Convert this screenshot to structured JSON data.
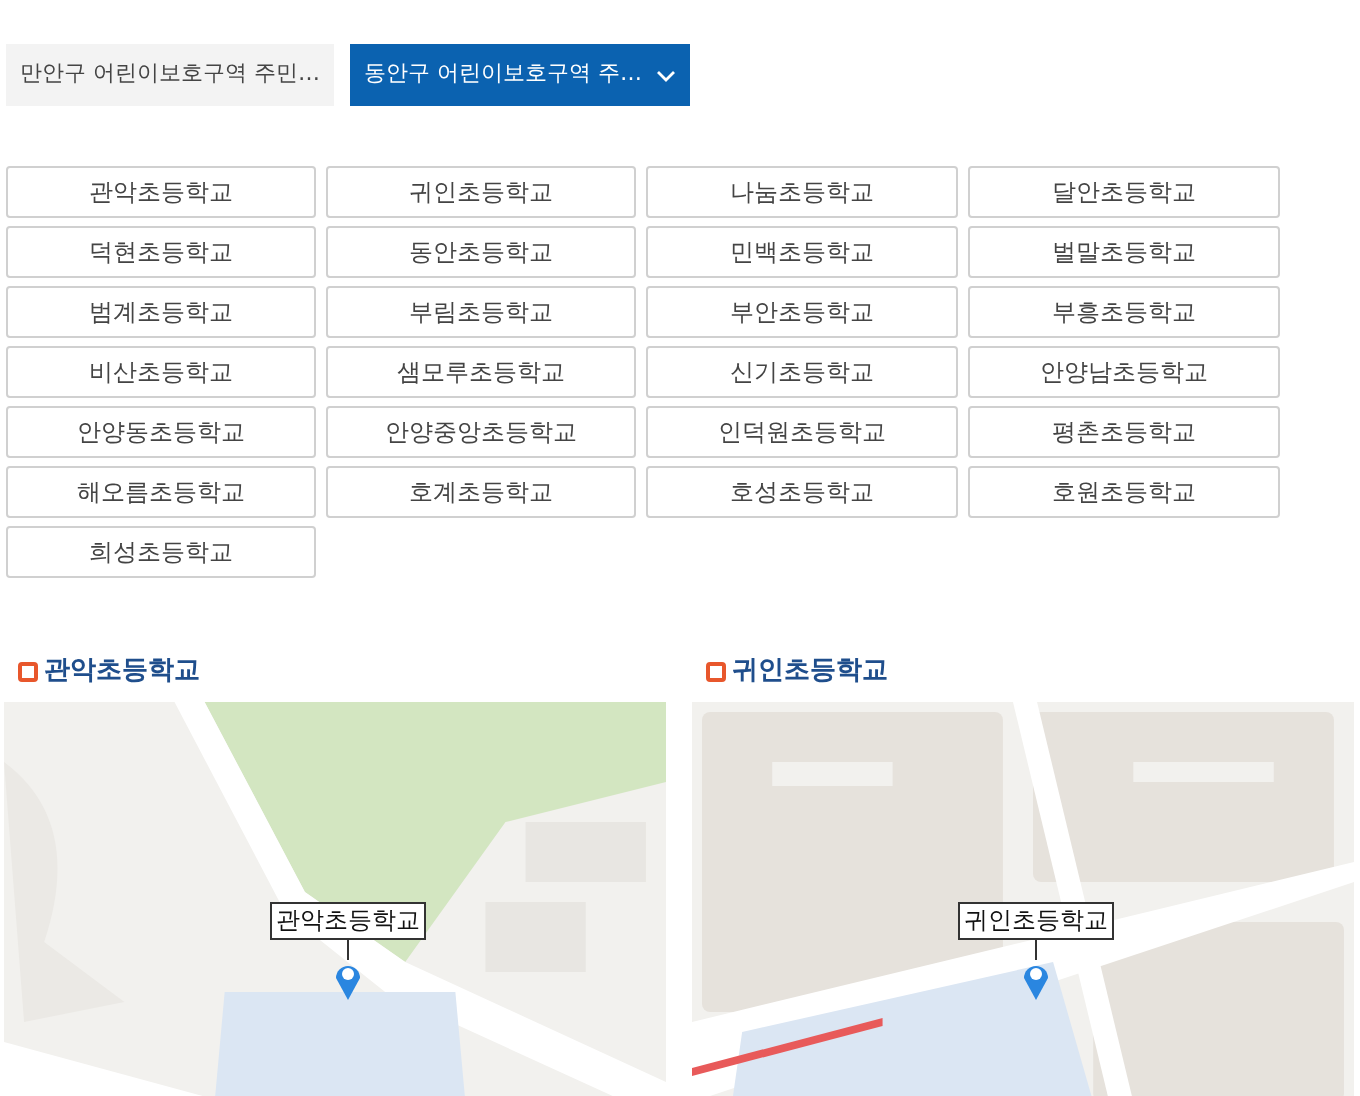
{
  "district_tabs": [
    {
      "label": "만안구 어린이보호구역 주민…",
      "selected": false
    },
    {
      "label": "동안구 어린이보호구역 주…",
      "selected": true
    }
  ],
  "schools": [
    "관악초등학교",
    "귀인초등학교",
    "나눔초등학교",
    "달안초등학교",
    "덕현초등학교",
    "동안초등학교",
    "민백초등학교",
    "벌말초등학교",
    "범계초등학교",
    "부림초등학교",
    "부안초등학교",
    "부흥초등학교",
    "비산초등학교",
    "샘모루초등학교",
    "신기초등학교",
    "안양남초등학교",
    "안양동초등학교",
    "안양중앙초등학교",
    "인덕원초등학교",
    "평촌초등학교",
    "해오름초등학교",
    "호계초등학교",
    "호성초등학교",
    "호원초등학교",
    "희성초등학교"
  ],
  "maps": [
    {
      "title": "관악초등학교",
      "marker_label": "관악초등학교",
      "kind": "park"
    },
    {
      "title": "귀인초등학교",
      "marker_label": "귀인초등학교",
      "kind": "blocks"
    }
  ]
}
